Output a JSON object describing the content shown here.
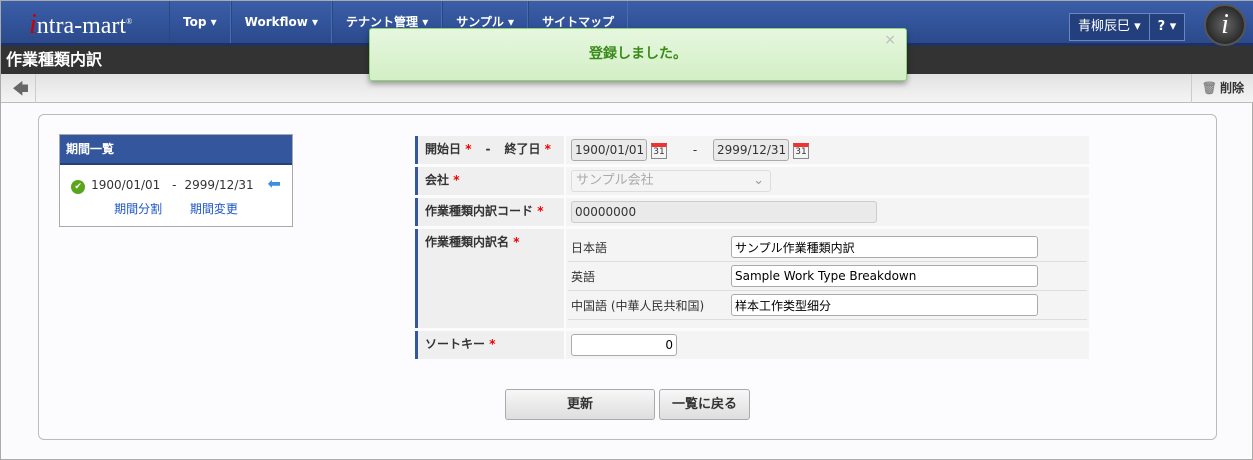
{
  "header": {
    "logo": "intra-mart",
    "menu": [
      "Top ▾",
      "Workflow ▾",
      "テナント管理 ▾",
      "サンプル ▾",
      "サイトマップ"
    ],
    "user": "青柳辰巳 ▾",
    "help": "? ▾"
  },
  "title": "作業種類内訳",
  "toolbar": {
    "back": "🡄",
    "delete": "削除"
  },
  "toast": {
    "message": "登録しました。",
    "close": "×"
  },
  "period_panel": {
    "title": "期間一覧",
    "start": "1900/01/01",
    "sep": "-",
    "end": "2999/12/31",
    "split": "期間分割",
    "change": "期間変更"
  },
  "form": {
    "start_label": "開始日",
    "end_label": "終了日",
    "sep": "-",
    "start": "1900/01/01",
    "end": "2999/12/31",
    "cal": "31",
    "company_label": "会社",
    "company": "サンプル会社",
    "code_label": "作業種類内訳コード",
    "code": "00000000",
    "name_label": "作業種類内訳名",
    "names": [
      {
        "lang": "日本語",
        "value": "サンプル作業種類内訳"
      },
      {
        "lang": "英語",
        "value": "Sample Work Type Breakdown"
      },
      {
        "lang": "中国語 (中華人民共和国)",
        "value": "样本工作类型细分"
      }
    ],
    "sort_label": "ソートキー",
    "sort": "0",
    "req": "*"
  },
  "buttons": {
    "update": "更新",
    "back_to_list": "一覧に戻る"
  }
}
